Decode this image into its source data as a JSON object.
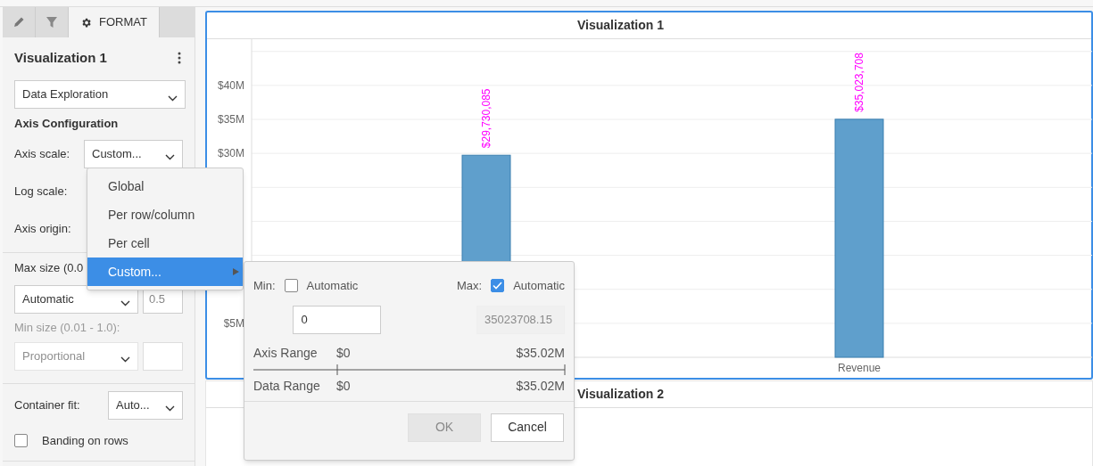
{
  "tabs": [
    {
      "selected": false
    },
    {
      "selected": false
    },
    {
      "label": "FORMAT",
      "selected": true
    }
  ],
  "panel": {
    "title": "Visualization 1",
    "view_select": "Data Exploration",
    "section": "Axis Configuration",
    "axis_scale": {
      "label": "Axis scale:",
      "value": "Custom..."
    },
    "log_scale": {
      "label": "Log scale:"
    },
    "axis_origin": {
      "label": "Axis origin:"
    },
    "max_size": {
      "label": "Max size (0.0",
      "select": "Automatic",
      "value": "0.5"
    },
    "min_size": {
      "label": "Min size (0.01 - 1.0):",
      "select": "Proportional",
      "disabled": true
    },
    "container_fit": {
      "label": "Container fit:",
      "value": "Auto..."
    },
    "banding": {
      "label": "Banding on rows",
      "checked": false
    }
  },
  "scale_menu": [
    {
      "label": "Global",
      "selected": false
    },
    {
      "label": "Per row/column",
      "selected": false
    },
    {
      "label": "Per cell",
      "selected": false
    },
    {
      "label": "Custom...",
      "selected": true
    }
  ],
  "custom_range": {
    "min": {
      "label": "Min:",
      "auto_label": "Automatic",
      "automatic": false,
      "value": "0"
    },
    "max": {
      "label": "Max:",
      "auto_label": "Automatic",
      "automatic": true,
      "value": "35023708.15"
    },
    "axis_range": {
      "label": "Axis Range",
      "from": "$0",
      "to": "$35.02M"
    },
    "data_range": {
      "label": "Data Range",
      "from": "$0",
      "to": "$35.02M"
    },
    "buttons": [
      {
        "label": "OK",
        "disabled": true
      },
      {
        "label": "Cancel",
        "disabled": false
      }
    ]
  },
  "visualizations": [
    {
      "title": "Visualization 1",
      "selected": true,
      "chart_data": {
        "type": "bar",
        "grid": true,
        "categories": [
          null,
          "Revenue"
        ],
        "values": [
          29730085,
          35023708
        ],
        "ylim": [
          0,
          46800000
        ],
        "yticks": [
          {
            "value": 5000000,
            "label": "$5M"
          },
          {
            "value": 30000000,
            "label": "$30M"
          },
          {
            "value": 35000000,
            "label": "$35M"
          },
          {
            "value": 40000000,
            "label": "$40M"
          }
        ],
        "value_labels": [
          "$29,730,085",
          "$35,023,708"
        ]
      }
    },
    {
      "title": "Visualization 2",
      "selected": false
    }
  ]
}
